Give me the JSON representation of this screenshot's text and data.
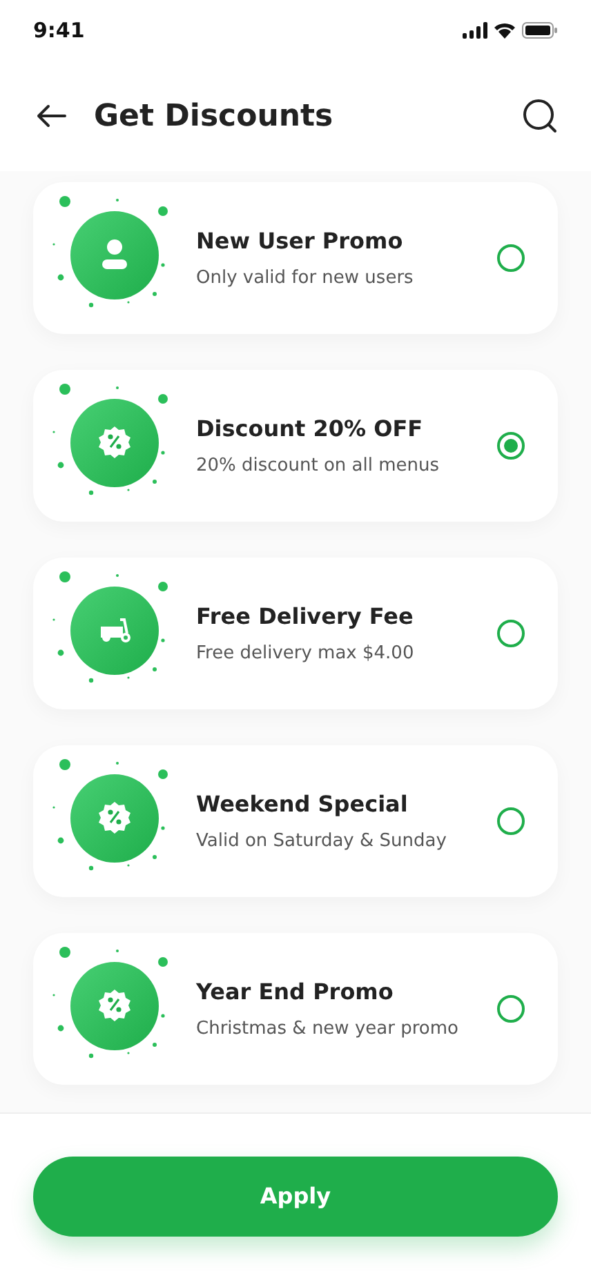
{
  "status_bar": {
    "time": "9:41"
  },
  "header": {
    "title": "Get Discounts"
  },
  "discounts": [
    {
      "kind": "user",
      "title": "New User Promo",
      "subtitle": "Only valid for new users",
      "selected": false
    },
    {
      "kind": "percent",
      "title": "Discount 20% OFF",
      "subtitle": "20% discount on all menus",
      "selected": true
    },
    {
      "kind": "scooter",
      "title": "Free Delivery Fee",
      "subtitle": "Free delivery max $4.00",
      "selected": false
    },
    {
      "kind": "percent",
      "title": "Weekend Special",
      "subtitle": "Valid on Saturday & Sunday",
      "selected": false
    },
    {
      "kind": "percent",
      "title": "Year End Promo",
      "subtitle": "Christmas & new year promo",
      "selected": false
    }
  ],
  "apply_button": "Apply"
}
